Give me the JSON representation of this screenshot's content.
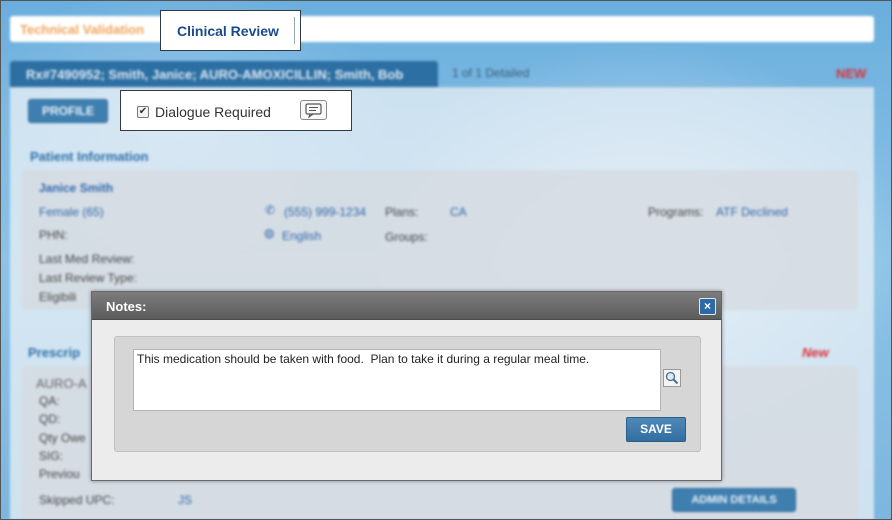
{
  "tabs": {
    "technical_validation": "Technical Validation",
    "clinical_review": "Clinical Review"
  },
  "rx_header": {
    "title": "Rx#7490952; Smith, Janice; AURO-AMOXICILLIN; Smith, Bob",
    "count": "1 of 1 Detailed",
    "badge": "NEW"
  },
  "toolbar": {
    "profile_label": "PROFILE",
    "dialogue_required_label": "Dialogue Required",
    "dialogue_required_checked": true
  },
  "patient": {
    "section_title": "Patient Information",
    "name": "Janice Smith",
    "gender_age": "Female (65)",
    "phn_label": "PHN:",
    "phone": "(555) 999-1234",
    "language": "English",
    "plans_label": "Plans:",
    "plans_value": "CA",
    "groups_label": "Groups:",
    "programs_label": "Programs:",
    "programs_value": "ATF Declined",
    "last_med_review_label": "Last Med Review:",
    "last_review_type_label": "Last Review Type:",
    "eligibility_label": "Eligibili"
  },
  "prescription": {
    "section_title": "Prescrip",
    "badge": "New",
    "drug": "AURO-A",
    "qa_label": "QA:",
    "qd_label": "QD:",
    "qty_owed_label": "Qty Owe",
    "sig_label": "SIG:",
    "previous_label": "Previou",
    "skipped_upc_label": "Skipped UPC:",
    "skipped_upc_value": "JS",
    "admin_details_label": "ADMIN DETAILS"
  },
  "modal": {
    "title": "Notes:",
    "close_glyph": "×",
    "note_text": "This medication should be taken with food.  Plan to take it during a regular meal time.",
    "save_label": "SAVE"
  },
  "colors": {
    "accent_blue": "#2c6fa3",
    "new_red": "#d8323a",
    "tab_orange": "#f0a35a",
    "modal_header": "#6a6a6a"
  }
}
